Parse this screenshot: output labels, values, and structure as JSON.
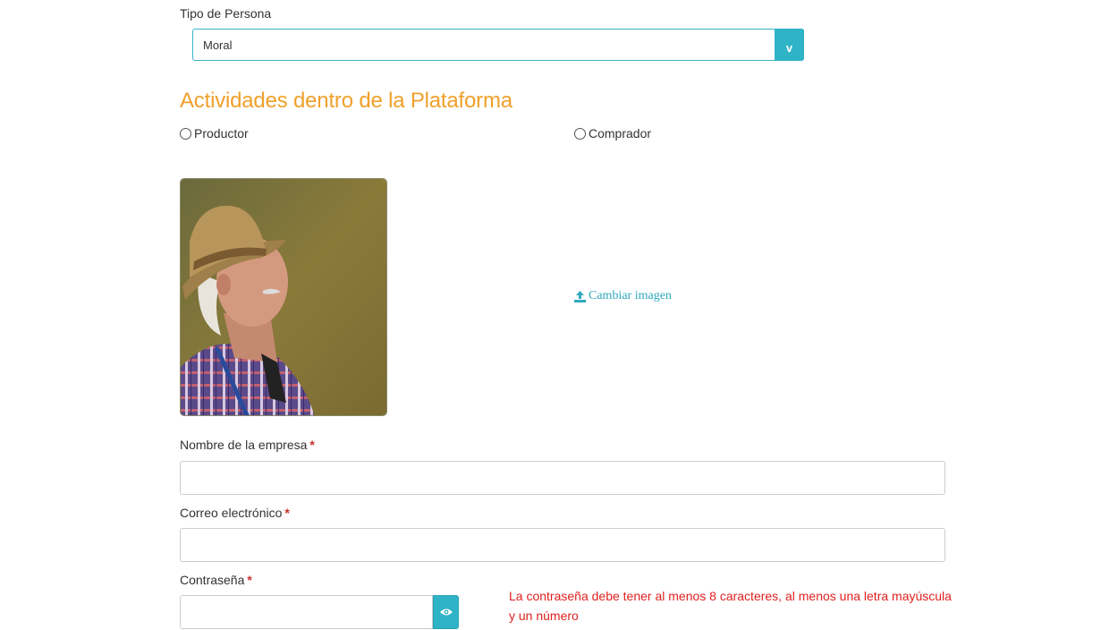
{
  "tipo_persona": {
    "label": "Tipo de Persona",
    "selected": "Moral",
    "arrow": "v"
  },
  "section": {
    "title": "Actividades dentro de la Plataforma"
  },
  "actividades": {
    "options": [
      {
        "label": "Productor",
        "checked": false
      },
      {
        "label": "Comprador",
        "checked": false
      }
    ]
  },
  "photo": {
    "icon": "profile-photo-farmer"
  },
  "change_image": {
    "label": "Cambiar imagen",
    "icon": "upload-icon"
  },
  "fields": {
    "empresa": {
      "label": "Nombre de la empresa",
      "required_mark": "*",
      "value": ""
    },
    "correo": {
      "label": "Correo electrónico",
      "required_mark": "*",
      "value": ""
    },
    "password": {
      "label": "Contraseña",
      "required_mark": "*",
      "value": "",
      "toggle_icon": "eye-icon",
      "hint": "La contraseña debe tener al menos 8 caracteres, al menos una letra mayúscula y un número"
    }
  },
  "colors": {
    "accent": "#2fb3c6",
    "section_title": "#f0a02b",
    "error": "#e02020",
    "required": "#c9302c"
  }
}
